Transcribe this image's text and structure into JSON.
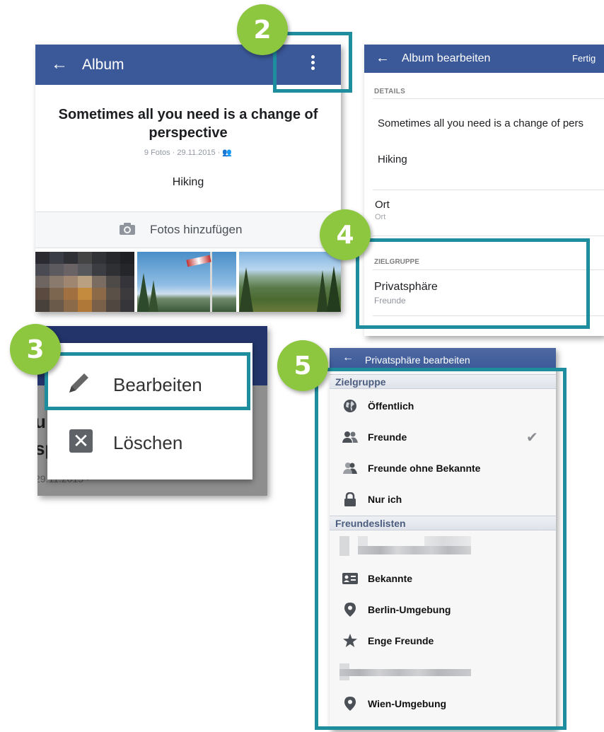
{
  "badges": [
    "2",
    "3",
    "4",
    "5"
  ],
  "album_screen": {
    "title": "Album",
    "album_title": "Sometimes all you need is a change of perspective",
    "meta": "9 Fotos · 29.11.2015 ·",
    "description": "Hiking",
    "add_photos_label": "Fotos hinzufügen"
  },
  "edit_screen": {
    "title": "Album bearbeiten",
    "done_label": "Fertig",
    "details_header": "DETAILS",
    "album_title_value": "Sometimes all you need is a change of pers",
    "description_value": "Hiking",
    "location_label": "Ort",
    "location_placeholder": "Ort",
    "audience_header": "ZIELGRUPPE",
    "privacy_label": "Privatsphäre",
    "privacy_value": "Freunde"
  },
  "menu_screen": {
    "edit_label": "Bearbeiten",
    "delete_label": "Löschen",
    "bg_title_fragment_1": "u",
    "bg_title_fragment_2": "sp",
    "bg_meta_fragment": "29.11.2015 ·"
  },
  "privacy_screen": {
    "title": "Privatsphäre bearbeiten",
    "section_audience": "Zielgruppe",
    "section_friend_lists": "Freundeslisten",
    "options": [
      {
        "label": "Öffentlich",
        "icon": "globe-icon"
      },
      {
        "label": "Freunde",
        "icon": "friends-icon",
        "selected": true
      },
      {
        "label": "Freunde ohne Bekannte",
        "icon": "friends-except-icon"
      },
      {
        "label": "Nur ich",
        "icon": "lock-icon"
      }
    ],
    "lists": [
      {
        "label": "Bekannte",
        "icon": "id-card-icon"
      },
      {
        "label": "Berlin-Umgebung",
        "icon": "location-pin-icon"
      },
      {
        "label": "Enge Freunde",
        "icon": "star-icon"
      },
      {
        "label": "Wien-Umgebung",
        "icon": "location-pin-icon"
      }
    ]
  },
  "colors": {
    "facebook_blue": "#3b5998",
    "highlight_teal": "#1e8e9e",
    "badge_green": "#8dc63f"
  }
}
